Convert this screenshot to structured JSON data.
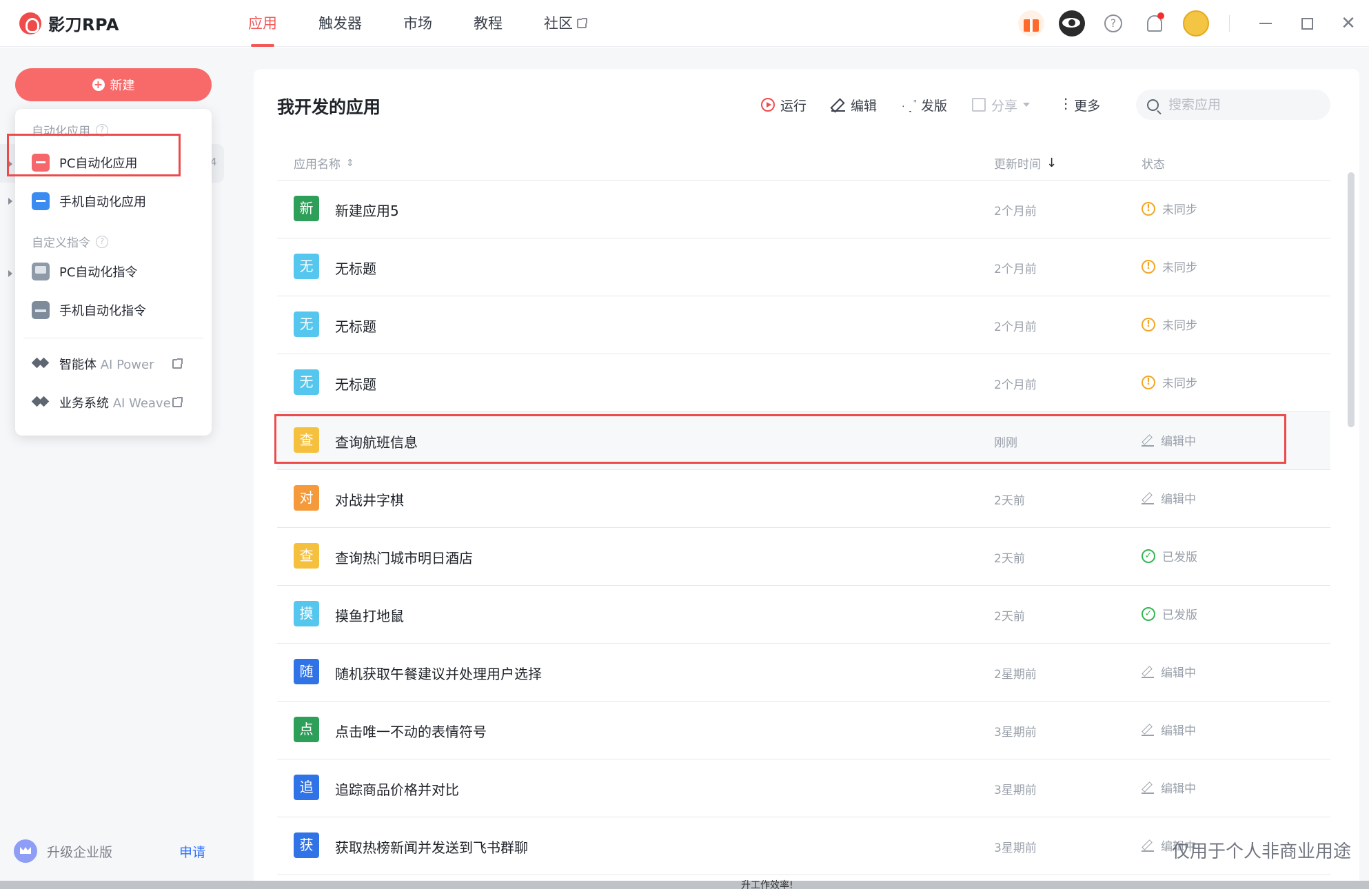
{
  "app": {
    "logo_text": "影刀RPA"
  },
  "nav": [
    {
      "label": "应用",
      "active": true
    },
    {
      "label": "触发器",
      "active": false
    },
    {
      "label": "市场",
      "active": false
    },
    {
      "label": "教程",
      "active": false
    },
    {
      "label": "社区",
      "active": false,
      "external": true
    }
  ],
  "topbar_icons": [
    "gift-icon",
    "eye-icon",
    "help-icon",
    "bell-icon",
    "avatar"
  ],
  "window_controls": [
    "minimize",
    "maximize",
    "close"
  ],
  "sidebar": {
    "new_button_label": "新建",
    "bg_item_count": "4",
    "upgrade_label": "升级企业版",
    "apply_label": "申请"
  },
  "menu": {
    "group_apps_label": "自动化应用",
    "group_cmds_label": "自定义指令",
    "items": [
      {
        "label": "PC自动化应用",
        "icon": "pc-app-icon"
      },
      {
        "label": "手机自动化应用",
        "icon": "mobile-app-icon"
      },
      {
        "label": "PC自动化指令",
        "icon": "pc-command-icon"
      },
      {
        "label": "手机自动化指令",
        "icon": "mobile-command-icon"
      }
    ],
    "ai_power": {
      "label": "智能体",
      "sub": "AI Power"
    },
    "ai_weave": {
      "label": "业务系统",
      "sub": "AI Weave"
    }
  },
  "main": {
    "title": "我开发的应用",
    "toolbar": {
      "run": "运行",
      "edit": "编辑",
      "publish": "发版",
      "share": "分享",
      "more": "更多"
    },
    "search_placeholder": "搜索应用",
    "columns": {
      "name": "应用名称",
      "updated": "更新时间",
      "status": "状态"
    }
  },
  "apps": [
    {
      "icon_char": "新",
      "color": "#2e9f58",
      "name": "新建应用5",
      "time": "2个月前",
      "status": "未同步",
      "status_type": "warn"
    },
    {
      "icon_char": "无",
      "color": "#55c7ee",
      "name": "无标题",
      "time": "2个月前",
      "status": "未同步",
      "status_type": "warn"
    },
    {
      "icon_char": "无",
      "color": "#55c7ee",
      "name": "无标题",
      "time": "2个月前",
      "status": "未同步",
      "status_type": "warn"
    },
    {
      "icon_char": "无",
      "color": "#55c7ee",
      "name": "无标题",
      "time": "2个月前",
      "status": "未同步",
      "status_type": "warn"
    },
    {
      "icon_char": "查",
      "color": "#f5c03e",
      "name": "查询航班信息",
      "time": "刚刚",
      "status": "编辑中",
      "status_type": "edit",
      "highlighted": true
    },
    {
      "icon_char": "对",
      "color": "#f59a3b",
      "name": "对战井字棋",
      "time": "2天前",
      "status": "编辑中",
      "status_type": "edit"
    },
    {
      "icon_char": "查",
      "color": "#f5c03e",
      "name": "查询热门城市明日酒店",
      "time": "2天前",
      "status": "已发版",
      "status_type": "ok"
    },
    {
      "icon_char": "摸",
      "color": "#55c7ee",
      "name": "摸鱼打地鼠",
      "time": "2天前",
      "status": "已发版",
      "status_type": "ok"
    },
    {
      "icon_char": "随",
      "color": "#2f73e6",
      "name": "随机获取午餐建议并处理用户选择",
      "time": "2星期前",
      "status": "编辑中",
      "status_type": "edit"
    },
    {
      "icon_char": "点",
      "color": "#2e9f58",
      "name": "点击唯一不动的表情符号",
      "time": "3星期前",
      "status": "编辑中",
      "status_type": "edit"
    },
    {
      "icon_char": "追",
      "color": "#2f73e6",
      "name": "追踪商品价格并对比",
      "time": "3星期前",
      "status": "编辑中",
      "status_type": "edit"
    },
    {
      "icon_char": "获",
      "color": "#2f73e6",
      "name": "获取热榜新闻并发送到飞书群聊",
      "time": "3星期前",
      "status": "编辑中",
      "status_type": "edit"
    }
  ],
  "watermark": "仅用于个人非商业用途",
  "bottom_fragment": "升工作效率!"
}
